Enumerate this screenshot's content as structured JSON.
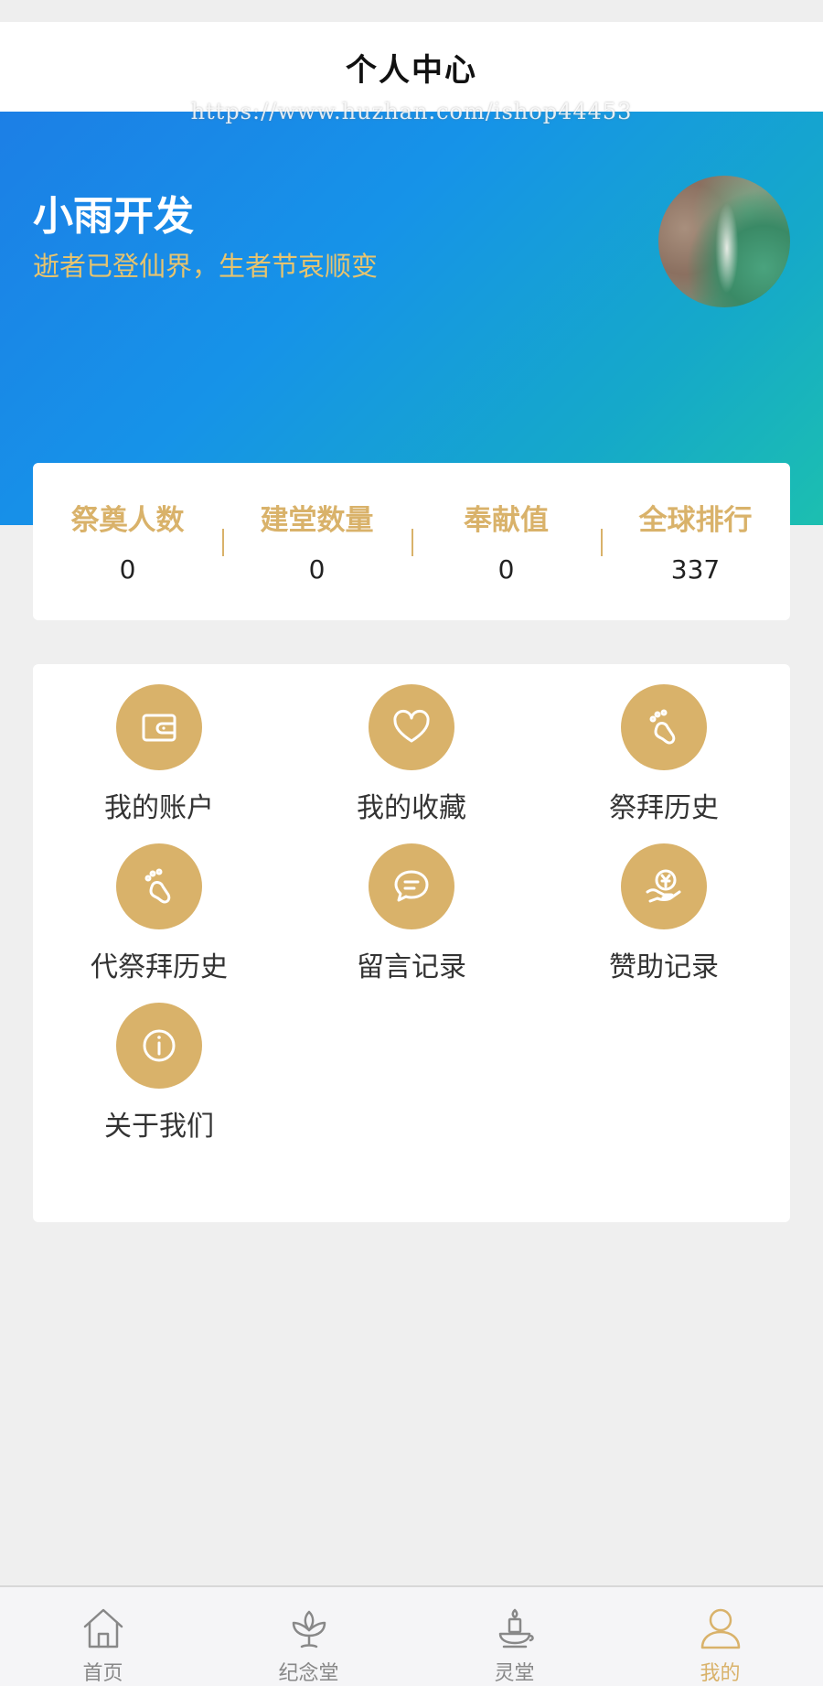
{
  "header": {
    "title": "个人中心",
    "watermark": "https://www.huzhan.com/ishop44453"
  },
  "profile": {
    "username": "小雨开发",
    "motto": "逝者已登仙界，生者节哀顺变"
  },
  "stats": [
    {
      "label": "祭奠人数",
      "value": "0"
    },
    {
      "label": "建堂数量",
      "value": "0"
    },
    {
      "label": "奉献值",
      "value": "0"
    },
    {
      "label": "全球排行",
      "value": "337"
    }
  ],
  "menu": [
    {
      "label": "我的账户",
      "icon": "wallet-icon"
    },
    {
      "label": "我的收藏",
      "icon": "heart-icon"
    },
    {
      "label": "祭拜历史",
      "icon": "footprint-icon"
    },
    {
      "label": "代祭拜历史",
      "icon": "footprint-icon"
    },
    {
      "label": "留言记录",
      "icon": "message-icon"
    },
    {
      "label": "赞助记录",
      "icon": "sponsor-icon"
    },
    {
      "label": "关于我们",
      "icon": "info-icon"
    }
  ],
  "tabbar": [
    {
      "label": "首页",
      "icon": "home-icon"
    },
    {
      "label": "纪念堂",
      "icon": "lotus-icon"
    },
    {
      "label": "灵堂",
      "icon": "candle-icon"
    },
    {
      "label": "我的",
      "icon": "user-icon",
      "active": true
    }
  ],
  "colors": {
    "accent": "#d9b26a",
    "hero_start": "#1c7fe6",
    "hero_end": "#1cbfb0",
    "background": "#efefef"
  }
}
